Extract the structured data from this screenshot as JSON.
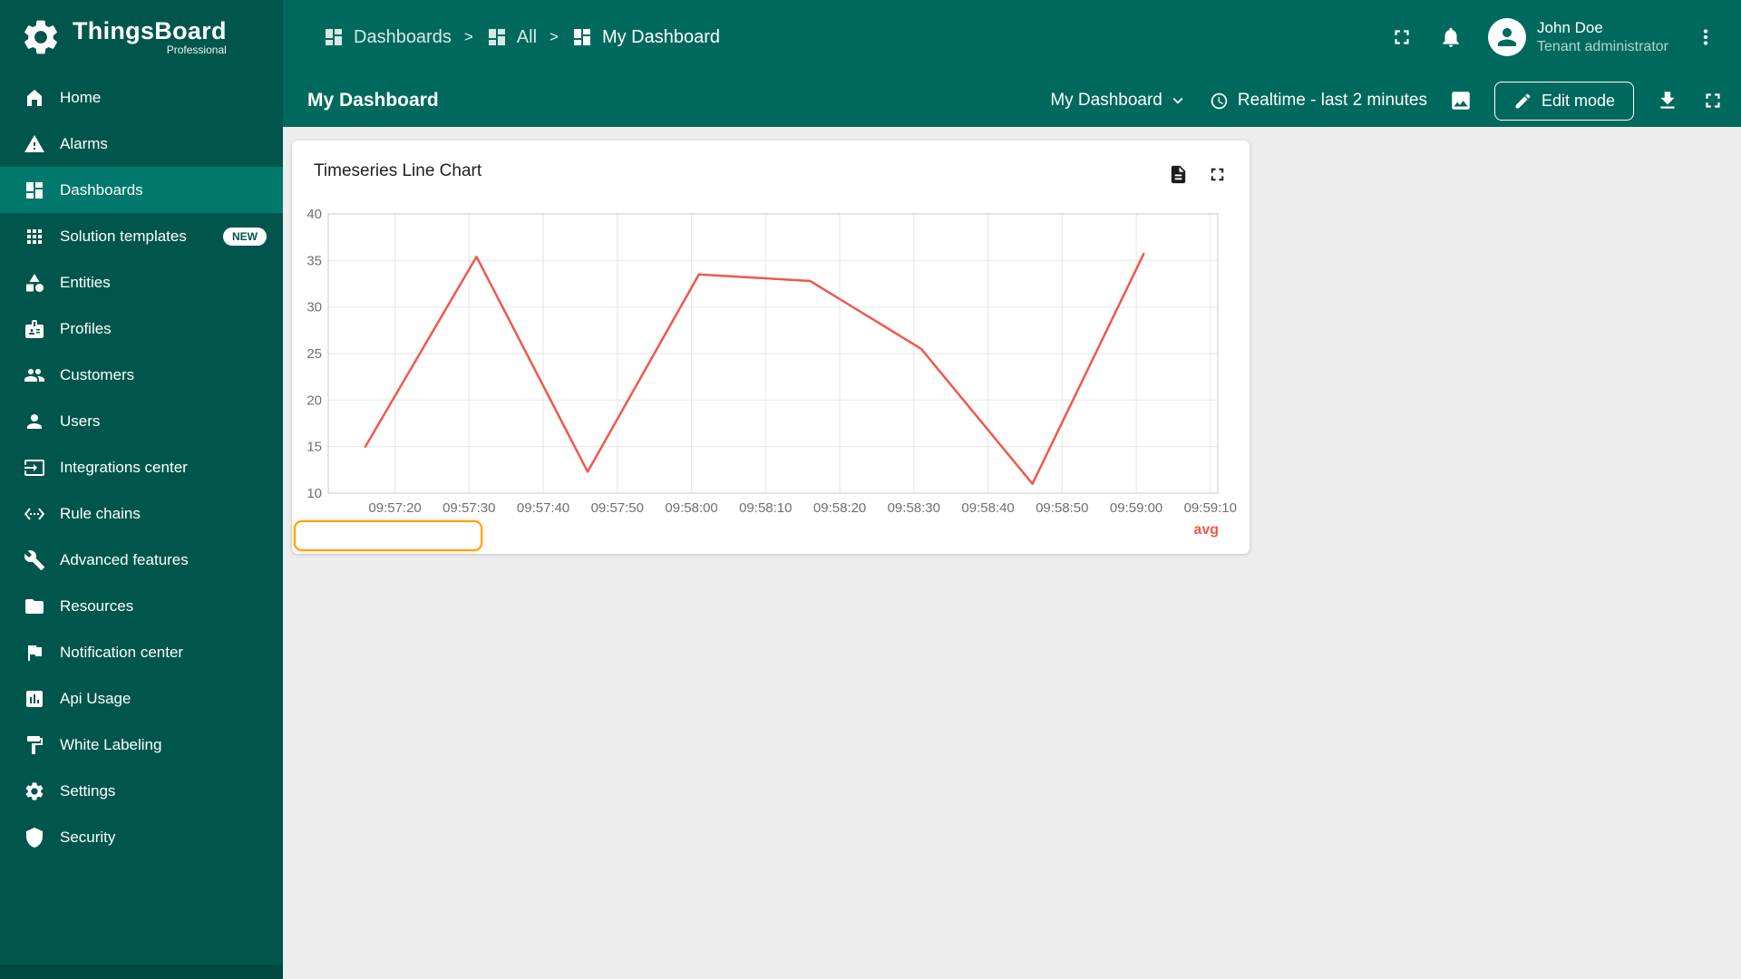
{
  "app": {
    "name": "ThingsBoard",
    "edition": "Professional"
  },
  "colors": {
    "sidebar": "#00564d",
    "sidebar_active": "#00786b",
    "topbar": "#00695e",
    "series_accent": "#f1574d",
    "highlight_border": "#ffa000"
  },
  "sidebar": {
    "items": [
      {
        "label": "Home",
        "icon": "home",
        "active": false,
        "expandable": false
      },
      {
        "label": "Alarms",
        "icon": "warning",
        "active": false,
        "expandable": false
      },
      {
        "label": "Dashboards",
        "icon": "dashboard",
        "active": true,
        "expandable": false
      },
      {
        "label": "Solution templates",
        "icon": "apps",
        "active": false,
        "expandable": false,
        "badge": "NEW"
      },
      {
        "label": "Entities",
        "icon": "category",
        "active": false,
        "expandable": true
      },
      {
        "label": "Profiles",
        "icon": "badge",
        "active": false,
        "expandable": true
      },
      {
        "label": "Customers",
        "icon": "people",
        "active": false,
        "expandable": false
      },
      {
        "label": "Users",
        "icon": "person",
        "active": false,
        "expandable": false
      },
      {
        "label": "Integrations center",
        "icon": "input",
        "active": false,
        "expandable": true
      },
      {
        "label": "Rule chains",
        "icon": "ethernet",
        "active": false,
        "expandable": false
      },
      {
        "label": "Advanced features",
        "icon": "build",
        "active": false,
        "expandable": true
      },
      {
        "label": "Resources",
        "icon": "folder",
        "active": false,
        "expandable": true
      },
      {
        "label": "Notification center",
        "icon": "flag",
        "active": false,
        "expandable": false
      },
      {
        "label": "Api Usage",
        "icon": "chart",
        "active": false,
        "expandable": false
      },
      {
        "label": "White Labeling",
        "icon": "paint",
        "active": false,
        "expandable": false
      },
      {
        "label": "Settings",
        "icon": "gear",
        "active": false,
        "expandable": false
      },
      {
        "label": "Security",
        "icon": "shield",
        "active": false,
        "expandable": true
      }
    ]
  },
  "breadcrumb": {
    "separator": ">",
    "items": [
      {
        "label": "Dashboards",
        "icon": "dashboard"
      },
      {
        "label": "All",
        "icon": "dashboard"
      },
      {
        "label": "My Dashboard",
        "icon": "dashboard"
      }
    ]
  },
  "topbar": {
    "user_name": "John Doe",
    "user_role": "Tenant administrator"
  },
  "toolbar": {
    "page_title": "My Dashboard",
    "dashboard_selector": "My Dashboard",
    "time_window": "Realtime - last 2 minutes",
    "edit_button": "Edit mode"
  },
  "widget": {
    "title": "Timeseries Line Chart"
  },
  "chart_data": {
    "type": "line",
    "title": "Timeseries Line Chart",
    "x_range": [
      "09:57:11",
      "09:59:11"
    ],
    "x_ticks": [
      "09:57:20",
      "09:57:30",
      "09:57:40",
      "09:57:50",
      "09:58:00",
      "09:58:10",
      "09:58:20",
      "09:58:30",
      "09:58:40",
      "09:58:50",
      "09:59:00",
      "09:59:10"
    ],
    "y_ticks": [
      10,
      15,
      20,
      25,
      30,
      35,
      40
    ],
    "ylim": [
      10,
      40
    ],
    "grid": true,
    "legend_position": "bottom-right",
    "legend": [
      {
        "name": "avg",
        "color": "#f1574d"
      }
    ],
    "series": [
      {
        "name": "avg",
        "color": "#f1574d",
        "points": [
          {
            "t": "09:57:16",
            "v": 15.0
          },
          {
            "t": "09:57:31",
            "v": 35.4
          },
          {
            "t": "09:57:46",
            "v": 12.3
          },
          {
            "t": "09:58:01",
            "v": 33.5
          },
          {
            "t": "09:58:16",
            "v": 32.8
          },
          {
            "t": "09:58:31",
            "v": 25.5
          },
          {
            "t": "09:58:46",
            "v": 11.0
          },
          {
            "t": "09:59:01",
            "v": 35.7
          }
        ]
      }
    ]
  }
}
